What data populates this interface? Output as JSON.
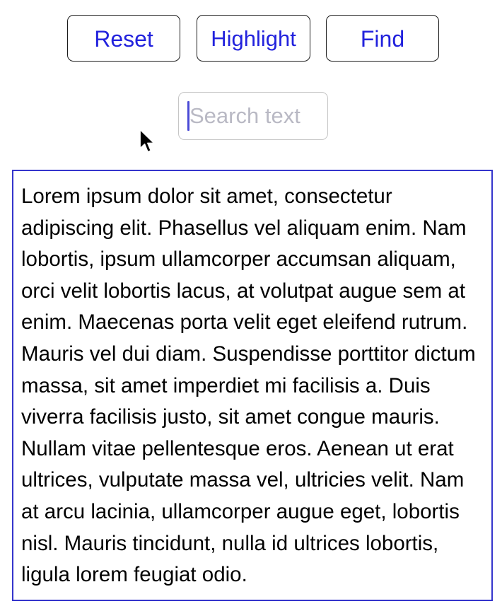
{
  "toolbar": {
    "reset_label": "Reset",
    "highlight_label": "Highlight",
    "find_label": "Find"
  },
  "search": {
    "value": "",
    "placeholder": "Search text"
  },
  "content": {
    "text": "Lorem ipsum dolor sit amet, consectetur adipiscing elit. Phasellus vel aliquam enim. Nam lobortis, ipsum ullamcorper accumsan aliquam, orci velit lobortis lacus, at volutpat augue sem at enim. Maecenas porta velit eget eleifend rutrum. Mauris vel dui diam. Suspendisse porttitor dictum massa, sit amet imperdiet mi facilisis a. Duis viverra facilisis justo, sit amet congue mauris. Nullam vitae pellentesque eros. Aenean ut erat ultrices, vulputate massa vel, ultricies velit. Nam at arcu lacinia, ullamcorper augue eget, lobortis nisl. Mauris tincidunt, nulla id ultrices lobortis, ligula lorem feugiat odio."
  },
  "icons": {
    "cursor": "mouse-pointer-icon"
  },
  "colors": {
    "button_text": "#2222dd",
    "button_border": "#1c1c1c",
    "text_box_border": "#3535cc",
    "placeholder": "#b9b9c4",
    "caret": "#4a4ad6"
  }
}
